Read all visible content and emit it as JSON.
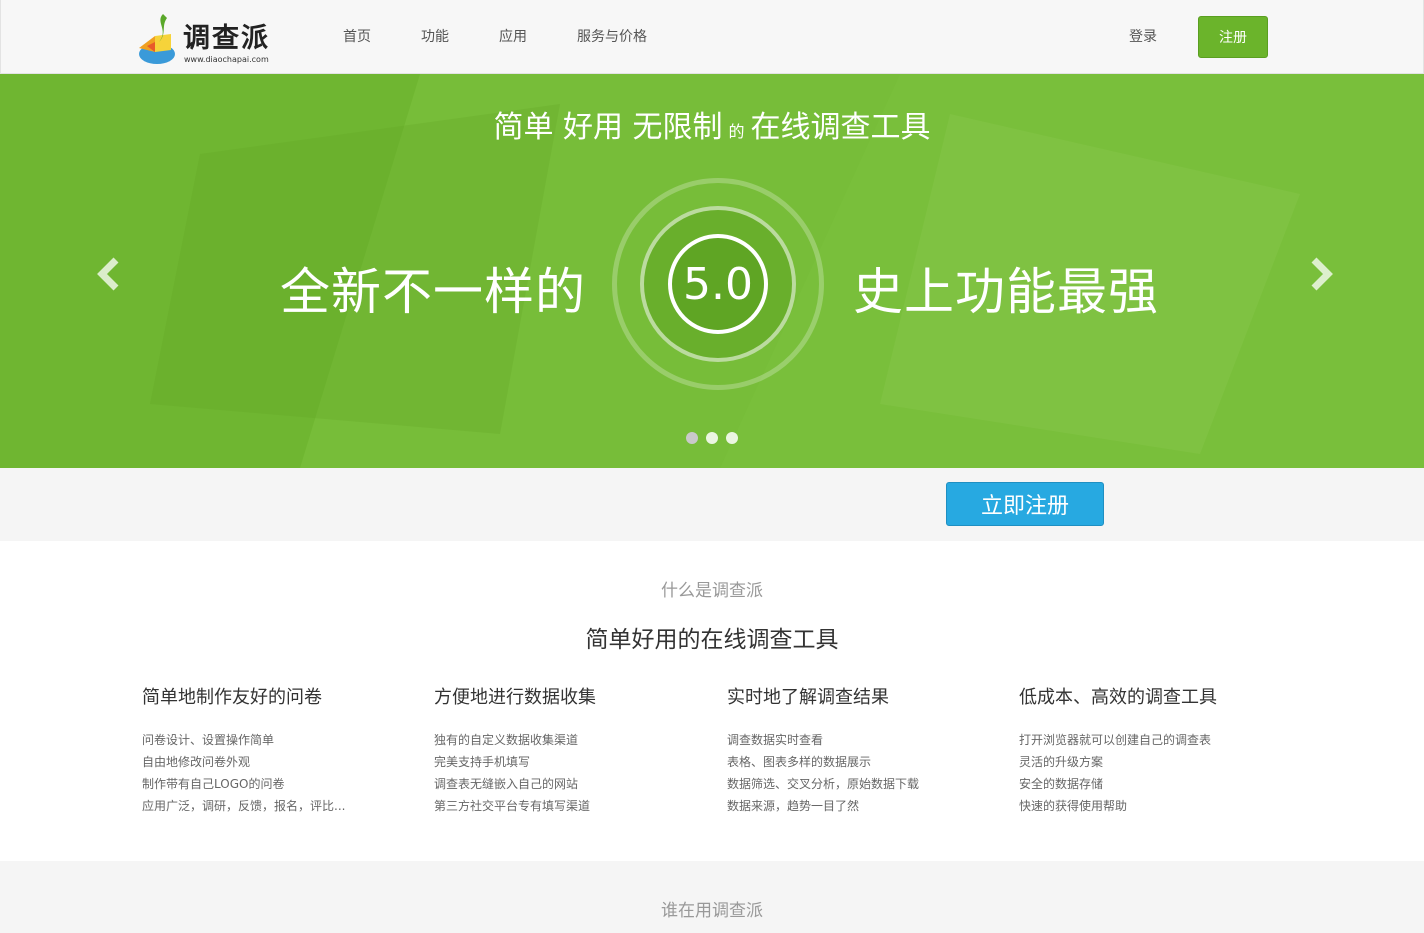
{
  "header": {
    "logo_text": "调查派",
    "logo_url": "www.diaochapai.com",
    "nav": [
      "首页",
      "功能",
      "应用",
      "服务与价格"
    ],
    "login_label": "登录",
    "register_label": "注册"
  },
  "banner": {
    "title_part1": "简单 好用 无限制",
    "title_small": "的",
    "title_part2": "在线调查工具",
    "left_text": "全新不一样的",
    "version": "5.0",
    "right_text": "史上功能最强",
    "slide_count": 3,
    "active_slide": 0,
    "prev_icon": "chevron-left-icon",
    "next_icon": "chevron-right-icon",
    "accent_color": "#74bb36"
  },
  "cta": {
    "label": "立即注册",
    "color": "#27a9e1"
  },
  "about": {
    "subtitle": "什么是调查派",
    "title": "简单好用的在线调查工具",
    "features": [
      {
        "heading": "简单地制作友好的问卷",
        "items": [
          "问卷设计、设置操作简单",
          "自由地修改问卷外观",
          "制作带有自己LOGO的问卷",
          "应用广泛，调研，反馈，报名，评比..."
        ]
      },
      {
        "heading": "方便地进行数据收集",
        "items": [
          "独有的自定义数据收集渠道",
          "完美支持手机填写",
          "调查表无缝嵌入自己的网站",
          "第三方社交平台专有填写渠道"
        ]
      },
      {
        "heading": "实时地了解调查结果",
        "items": [
          "调查数据实时查看",
          "表格、图表多样的数据展示",
          "数据筛选、交叉分析，原始数据下载",
          "数据来源，趋势一目了然"
        ]
      },
      {
        "heading": "低成本、高效的调查工具",
        "items": [
          "打开浏览器就可以创建自己的调查表",
          "灵活的升级方案",
          "安全的数据存储",
          "快速的获得使用帮助"
        ]
      }
    ]
  },
  "who": {
    "title": "谁在用调查派"
  }
}
